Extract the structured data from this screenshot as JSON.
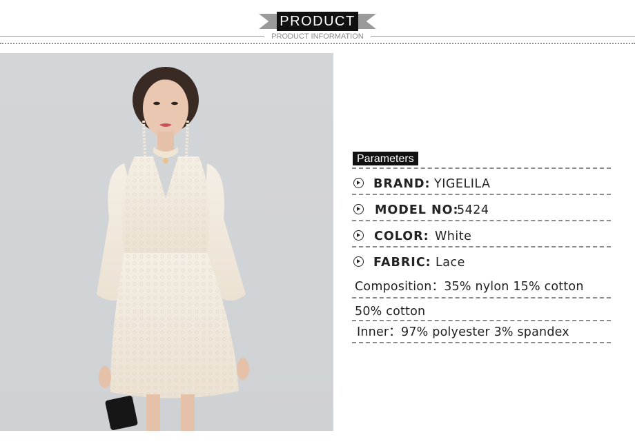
{
  "header": {
    "title": "PRODUCT",
    "subtitle": "PRODUCT INFORMATION"
  },
  "product_image": {
    "icon": "woman-in-white-lace-dress-image"
  },
  "parameters": {
    "heading": "Parameters",
    "rows": [
      {
        "label": "BRAND:",
        "value": "YIGELILA"
      },
      {
        "label": "MODEL NO:",
        "value": "5424"
      },
      {
        "label": "COLOR:",
        "value": "White"
      },
      {
        "label": "FABRIC:",
        "value": "Lace"
      }
    ],
    "composition": "Composition：35% nylon 15% cotton",
    "composition_cont": "50% cotton",
    "inner": "Inner：97% polyester 3% spandex"
  }
}
